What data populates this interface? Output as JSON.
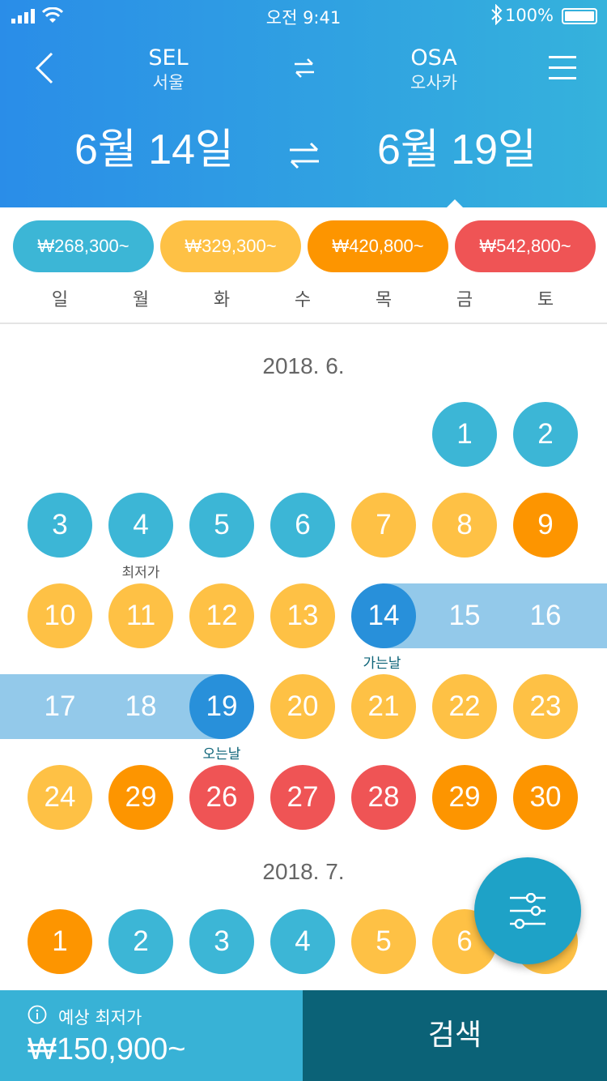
{
  "status": {
    "time": "오전 9:41",
    "battery": "100%"
  },
  "header": {
    "origin_code": "SEL",
    "origin_name": "서울",
    "dest_code": "OSA",
    "dest_name": "오사카",
    "depart_date": "6월 14일",
    "return_date": "6월 19일"
  },
  "price_legend": [
    {
      "label": "₩268,300~",
      "color": "#3cb6d6"
    },
    {
      "label": "₩329,300~",
      "color": "#fec145"
    },
    {
      "label": "₩420,800~",
      "color": "#fd9500"
    },
    {
      "label": "₩542,800~",
      "color": "#ef5455"
    }
  ],
  "weekdays": [
    "일",
    "월",
    "화",
    "수",
    "목",
    "금",
    "토"
  ],
  "calendar": {
    "month1_title": "2018. 6.",
    "month2_title": "2018. 7.",
    "june": [
      {
        "day": "1",
        "level": "blue"
      },
      {
        "day": "2",
        "level": "blue"
      },
      {
        "day": "3",
        "level": "blue"
      },
      {
        "day": "4",
        "level": "blue"
      },
      {
        "day": "5",
        "level": "blue"
      },
      {
        "day": "6",
        "level": "blue"
      },
      {
        "day": "7",
        "level": "yellow"
      },
      {
        "day": "8",
        "level": "yellow"
      },
      {
        "day": "9",
        "level": "orange"
      },
      {
        "day": "10",
        "level": "yellow"
      },
      {
        "day": "11",
        "level": "yellow"
      },
      {
        "day": "12",
        "level": "yellow"
      },
      {
        "day": "13",
        "level": "yellow"
      },
      {
        "day": "14",
        "level": "selected"
      },
      {
        "day": "15",
        "level": "range"
      },
      {
        "day": "16",
        "level": "range"
      },
      {
        "day": "17",
        "level": "range"
      },
      {
        "day": "18",
        "level": "range"
      },
      {
        "day": "19",
        "level": "selected"
      },
      {
        "day": "20",
        "level": "yellow"
      },
      {
        "day": "21",
        "level": "yellow"
      },
      {
        "day": "22",
        "level": "yellow"
      },
      {
        "day": "23",
        "level": "yellow"
      },
      {
        "day": "24",
        "level": "yellow"
      },
      {
        "day": "29",
        "level": "orange"
      },
      {
        "day": "26",
        "level": "red"
      },
      {
        "day": "27",
        "level": "red"
      },
      {
        "day": "28",
        "level": "red"
      },
      {
        "day": "29",
        "level": "orange"
      },
      {
        "day": "30",
        "level": "orange"
      }
    ],
    "july": [
      {
        "day": "1",
        "level": "orange"
      },
      {
        "day": "2",
        "level": "blue"
      },
      {
        "day": "3",
        "level": "blue"
      },
      {
        "day": "4",
        "level": "blue"
      },
      {
        "day": "5",
        "level": "yellow"
      },
      {
        "day": "6",
        "level": "yellow"
      },
      {
        "day": "7",
        "level": "yellow"
      }
    ],
    "lowest_label": "최저가",
    "depart_label": "가는날",
    "return_label": "오는날"
  },
  "footer": {
    "estimate_label": "예상 최저가",
    "estimate_price": "₩150,900~",
    "search_label": "검색"
  },
  "colors": {
    "blue": "#3cb6d6",
    "yellow": "#fec145",
    "orange": "#fd9500",
    "red": "#ef5455",
    "selected": "#2890da",
    "range": "#93c9ea",
    "label_teal": "#0b6277"
  }
}
